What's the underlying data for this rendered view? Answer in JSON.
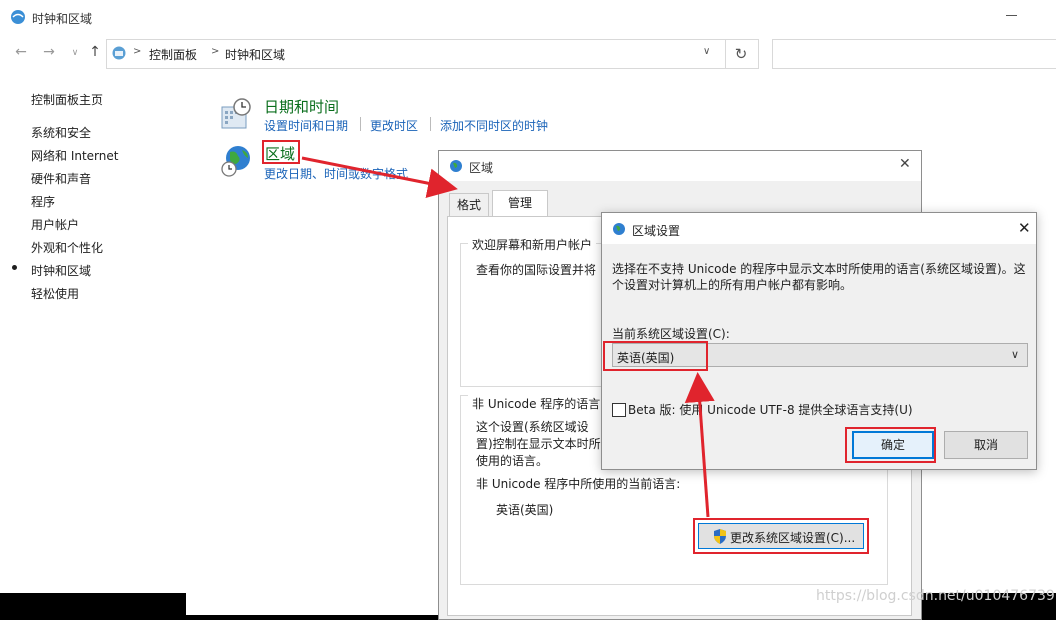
{
  "window": {
    "title": "时钟和区域",
    "breadcrumb": [
      "控制面板",
      "时钟和区域"
    ],
    "nav_icons": [
      "back-arrow-icon",
      "forward-arrow-icon",
      "up-arrow-icon",
      "refresh-icon"
    ]
  },
  "sidebar": {
    "home": "控制面板主页",
    "items": [
      "系统和安全",
      "网络和 Internet",
      "硬件和声音",
      "程序",
      "用户帐户",
      "外观和个性化",
      "时钟和区域",
      "轻松使用"
    ],
    "current": "时钟和区域"
  },
  "categories": {
    "datetime": {
      "title": "日期和时间",
      "links": [
        "设置时间和日期",
        "更改时区",
        "添加不同时区的时钟"
      ]
    },
    "region": {
      "title": "区域",
      "link": "更改日期、时间或数字格式"
    }
  },
  "region_dialog": {
    "title": "区域",
    "tabs": [
      "格式",
      "管理"
    ],
    "active_tab": "管理",
    "welcome_group_title": "欢迎屏幕和新用户帐户",
    "welcome_text": "查看你的国际设置并将其",
    "unicode_group_title": "非 Unicode 程序的语言",
    "unicode_desc": "这个设置(系统区域设置)控制在显示文本时所使用的语言。",
    "current_lang_label": "非 Unicode 程序中所使用的当前语言:",
    "current_lang_value": "英语(英国)",
    "change_button": "更改系统区域设置(C)..."
  },
  "locale_dialog": {
    "title": "区域设置",
    "description": "选择在不支持 Unicode 的程序中显示文本时所使用的语言(系统区域设置)。这个设置对计算机上的所有用户帐户都有影响。",
    "current_label": "当前系统区域设置(C):",
    "selected_locale": "英语(英国)",
    "beta_label": "Beta 版: 使用 Unicode UTF-8 提供全球语言支持(U)",
    "beta_checked": false,
    "ok": "确定",
    "cancel": "取消"
  },
  "watermark": "https://blog.csdn.net/u010476739",
  "colors": {
    "annotation": "#e0242d",
    "link": "#1a63b8",
    "category_title": "#0a6e1c",
    "focus_blue": "#0078d7"
  }
}
